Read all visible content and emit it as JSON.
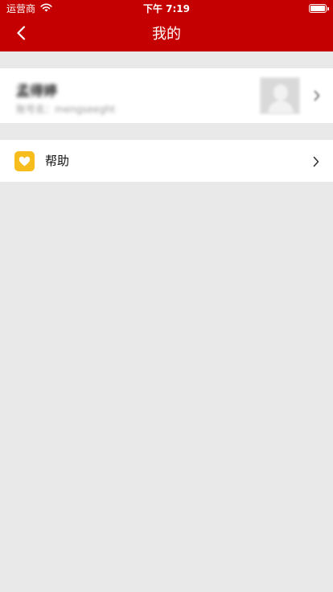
{
  "status_bar": {
    "carrier": "运营商",
    "time": "下午 7:19"
  },
  "nav": {
    "title": "我的"
  },
  "profile": {
    "name": "孟得婷",
    "account": "账号名：mengseeght"
  },
  "menu": {
    "help_label": "帮助"
  },
  "colors": {
    "brand_red": "#c40000",
    "help_icon_bg": "#f7bd1d",
    "page_bg": "#e9e9e9"
  },
  "icons": {
    "back": "chevron-left-icon",
    "wifi": "wifi-icon",
    "battery": "battery-icon",
    "help": "heart-icon",
    "disclosure": "chevron-right-icon"
  }
}
